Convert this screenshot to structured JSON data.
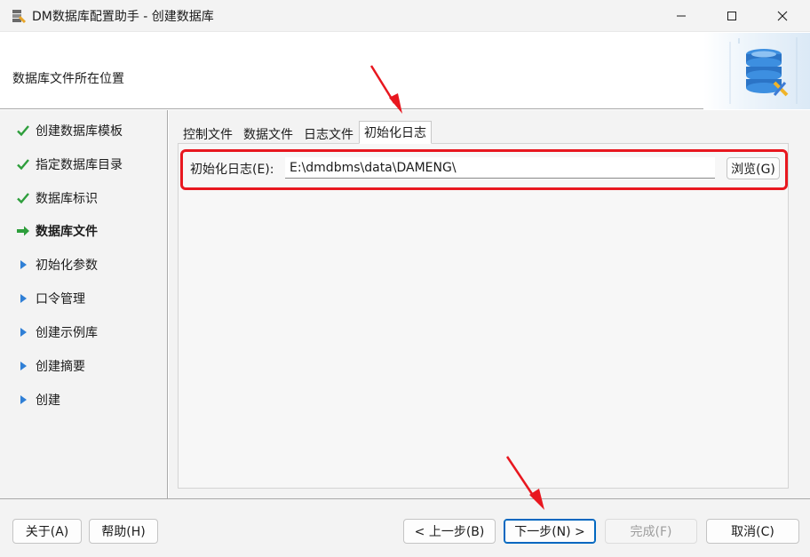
{
  "window": {
    "title": "DM数据库配置助手 - 创建数据库"
  },
  "header": {
    "title": "数据库文件所在位置"
  },
  "steps": [
    {
      "label": "创建数据库模板",
      "status": "done"
    },
    {
      "label": "指定数据库目录",
      "status": "done"
    },
    {
      "label": "数据库标识",
      "status": "done"
    },
    {
      "label": "数据库文件",
      "status": "current"
    },
    {
      "label": "初始化参数",
      "status": "pending"
    },
    {
      "label": "口令管理",
      "status": "pending"
    },
    {
      "label": "创建示例库",
      "status": "pending"
    },
    {
      "label": "创建摘要",
      "status": "pending"
    },
    {
      "label": "创建",
      "status": "pending"
    }
  ],
  "tabs": [
    {
      "label": "控制文件",
      "active": false
    },
    {
      "label": "数据文件",
      "active": false
    },
    {
      "label": "日志文件",
      "active": false
    },
    {
      "label": "初始化日志",
      "active": true
    }
  ],
  "init_log": {
    "label": "初始化日志(E):",
    "value": "E:\\dmdbms\\data\\DAMENG\\",
    "browse_label": "浏览(G)"
  },
  "footer": {
    "about": "关于(A)",
    "help": "帮助(H)",
    "prev": "< 上一步(B)",
    "next": "下一步(N) >",
    "finish": "完成(F)",
    "cancel": "取消(C)"
  },
  "colors": {
    "done_check": "#2e9e3c",
    "current_arrow": "#2e9e3c",
    "pending_triangle": "#2f7fd6",
    "highlight_box": "#e8171f",
    "annotation_arrow": "#e8171f",
    "primary_border": "#0067c0"
  },
  "icons": {
    "done": "check-icon",
    "current": "right-arrow-icon",
    "pending": "triangle-right-icon"
  }
}
